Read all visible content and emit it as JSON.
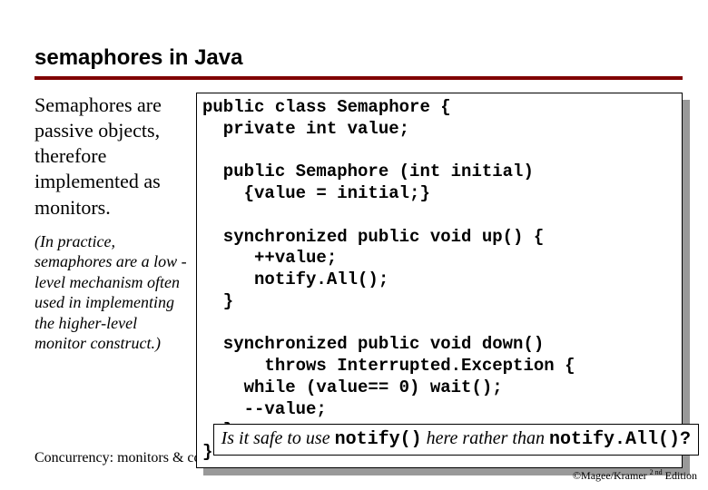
{
  "title": "semaphores in Java",
  "left": {
    "para1": "Semaphores are passive objects, therefore implemented as monitors.",
    "para2": "(In practice, semaphores are a low -level mechanism often used in implementing the higher-level monitor construct.)"
  },
  "code": "public class Semaphore {\n  private int value;\n\n  public Semaphore (int initial)\n    {value = initial;}\n\n  synchronized public void up() {\n     ++value;\n     notify.All();\n  }\n\n  synchronized public void down()\n      throws Interrupted.Exception {\n    while (value== 0) wait();\n    --value;\n  }\n}",
  "question": {
    "pre": "Is it safe to use ",
    "code1": "notify()",
    "mid": " here\nrather than ",
    "code2": "notify.All()?"
  },
  "footer": {
    "left": "Concurrency: monitors & condition synchronization",
    "right_pre": "©Magee/Kramer ",
    "right_sup": "2 nd",
    "right_post": " Edition"
  }
}
